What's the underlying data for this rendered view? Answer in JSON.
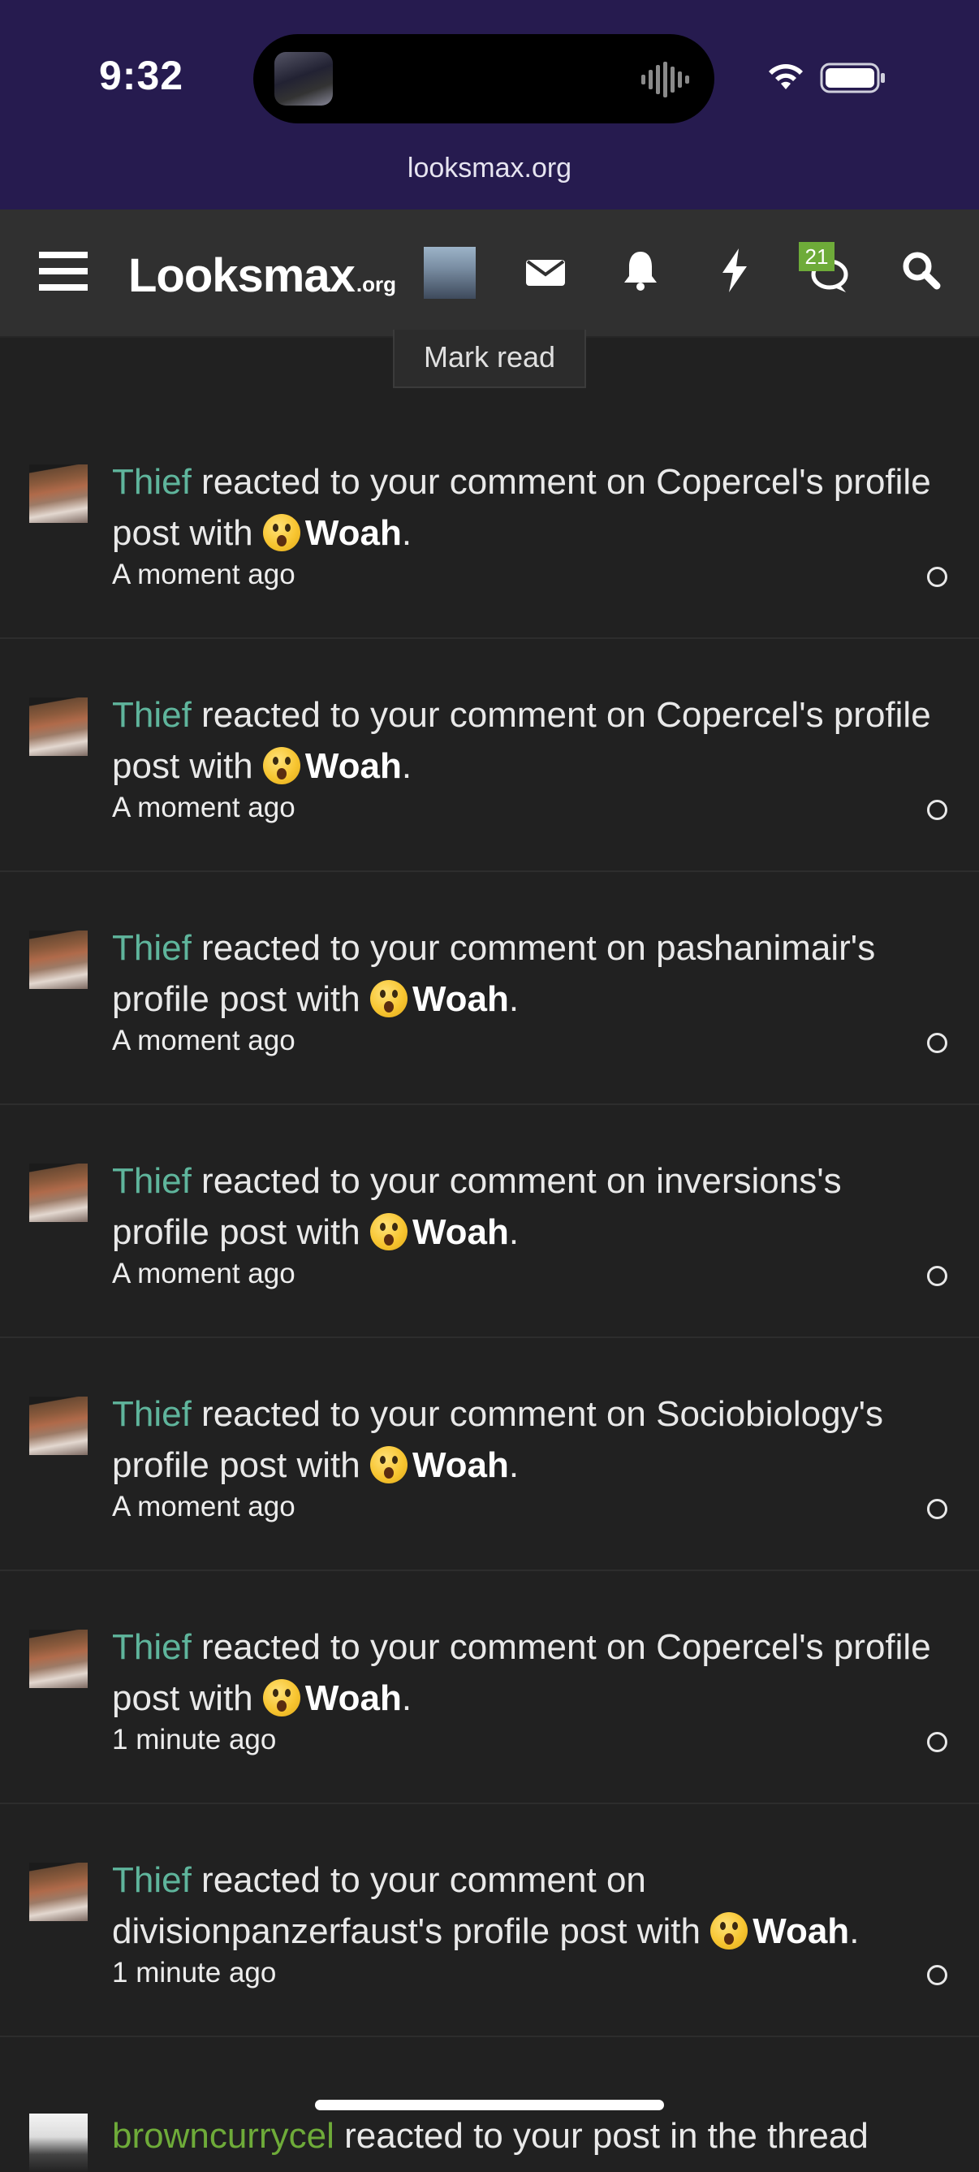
{
  "status": {
    "time": "9:32",
    "url": "looksmax.org"
  },
  "nav": {
    "logo": "Looksmax",
    "logo_suffix": ".org",
    "badge_count": "21"
  },
  "mark_read_label": "Mark read",
  "notifications": [
    {
      "user": "Thief",
      "pre": " reacted to your comment on Copercel's profile post with ",
      "reaction": "Woah",
      "post": ".",
      "time": "A moment ago"
    },
    {
      "user": "Thief",
      "pre": " reacted to your comment on Copercel's profile post with ",
      "reaction": "Woah",
      "post": ".",
      "time": "A moment ago"
    },
    {
      "user": "Thief",
      "pre": " reacted to your comment on pashanimair's profile post with ",
      "reaction": "Woah",
      "post": ".",
      "time": "A moment ago"
    },
    {
      "user": "Thief",
      "pre": " reacted to your comment on inversions's profile post with ",
      "reaction": "Woah",
      "post": ".",
      "time": "A moment ago"
    },
    {
      "user": "Thief",
      "pre": " reacted to your comment on Sociobiology's profile post with ",
      "reaction": "Woah",
      "post": ".",
      "time": "A moment ago"
    },
    {
      "user": "Thief",
      "pre": " reacted to your comment on Copercel's profile post with ",
      "reaction": "Woah",
      "post": ".",
      "time": "1 minute ago"
    },
    {
      "user": "Thief",
      "pre": " reacted to your comment on divisionpanzerfaust's profile post with ",
      "reaction": "Woah",
      "post": ".",
      "time": "1 minute ago"
    }
  ],
  "partial_notification": {
    "user": "browncurrycel",
    "text": " reacted to your post in the thread"
  },
  "colors": {
    "status_bg": "#261b4f",
    "navbar_bg": "#303030",
    "page_bg": "#212121",
    "username": "#5fb59c",
    "badge": "#6eab39"
  }
}
